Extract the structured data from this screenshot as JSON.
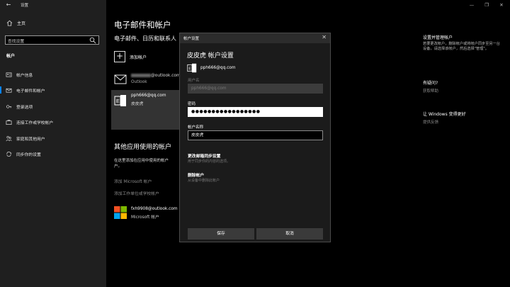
{
  "window": {
    "title": "设置",
    "back_glyph": "←",
    "minimize_glyph": "—",
    "restore_glyph": "❐",
    "close_glyph": "✕"
  },
  "sidebar": {
    "home_label": "主页",
    "search_placeholder": "查找设置",
    "section_title": "帐户",
    "items": [
      {
        "label": "帐户信息",
        "icon": "account-info-icon"
      },
      {
        "label": "电子邮件和帐户",
        "icon": "email-icon",
        "active": true
      },
      {
        "label": "登录选项",
        "icon": "key-icon"
      },
      {
        "label": "连接工作或学校帐户",
        "icon": "briefcase-icon"
      },
      {
        "label": "家庭和其他用户",
        "icon": "family-icon"
      },
      {
        "label": "同步你的设置",
        "icon": "sync-icon"
      }
    ]
  },
  "main": {
    "title": "电子邮件和帐户",
    "subtitle": "电子邮件、日历和联系人",
    "add_account_label": "添加帐户",
    "accounts": [
      {
        "email_suffix": "@outlook.com",
        "type": "Outlook"
      },
      {
        "email": "pph666@qq.com",
        "name": "皮皮虎"
      }
    ],
    "other_apps_title": "其他应用使用的帐户",
    "other_apps_desc_line1": "在这里添加在应用中使用的帐户",
    "other_apps_desc_line2": "户。",
    "add_microsoft_account": "添加 Microsoft 帐户",
    "add_work_account": "添加工作单位或学校帐户",
    "ms_account_email": "fxh9908@outlook.com",
    "ms_account_type": "Microsoft 帐户"
  },
  "right_column": {
    "manage_title": "设置并管理帐户",
    "manage_text": "若要更改帐户，删除帐户或将帐户同步至另一台设备，请选择该帐户，然后选择\"管理\"。",
    "question_title": "有疑问?",
    "help_link": "获取帮助",
    "improve_title": "让 Windows 变得更好",
    "feedback_link": "提供反馈"
  },
  "dialog": {
    "bar_title": "帐户设置",
    "close_glyph": "✕",
    "title": "皮皮虎 帐户设置",
    "account_email": "pph666@qq.com",
    "username_label": "用户名",
    "username_value": "pph666@qq.com",
    "password_label": "密码",
    "password_value": "●●●●●●●●●●●●●●●●●",
    "account_name_label": "帐户名称",
    "account_name_value": "皮皮虎",
    "change_sync_label": "更改邮箱同步设置",
    "change_sync_note": "用于同步你的内容的选项。",
    "delete_account_label": "删除帐户",
    "delete_account_note": "从设备中删除此帐户",
    "save_label": "保存",
    "cancel_label": "取消"
  },
  "colors": {
    "accent": "#0a84ff",
    "ms_red": "#f25022",
    "ms_green": "#7fba00",
    "ms_blue": "#00a4ef",
    "ms_yellow": "#ffb900"
  }
}
